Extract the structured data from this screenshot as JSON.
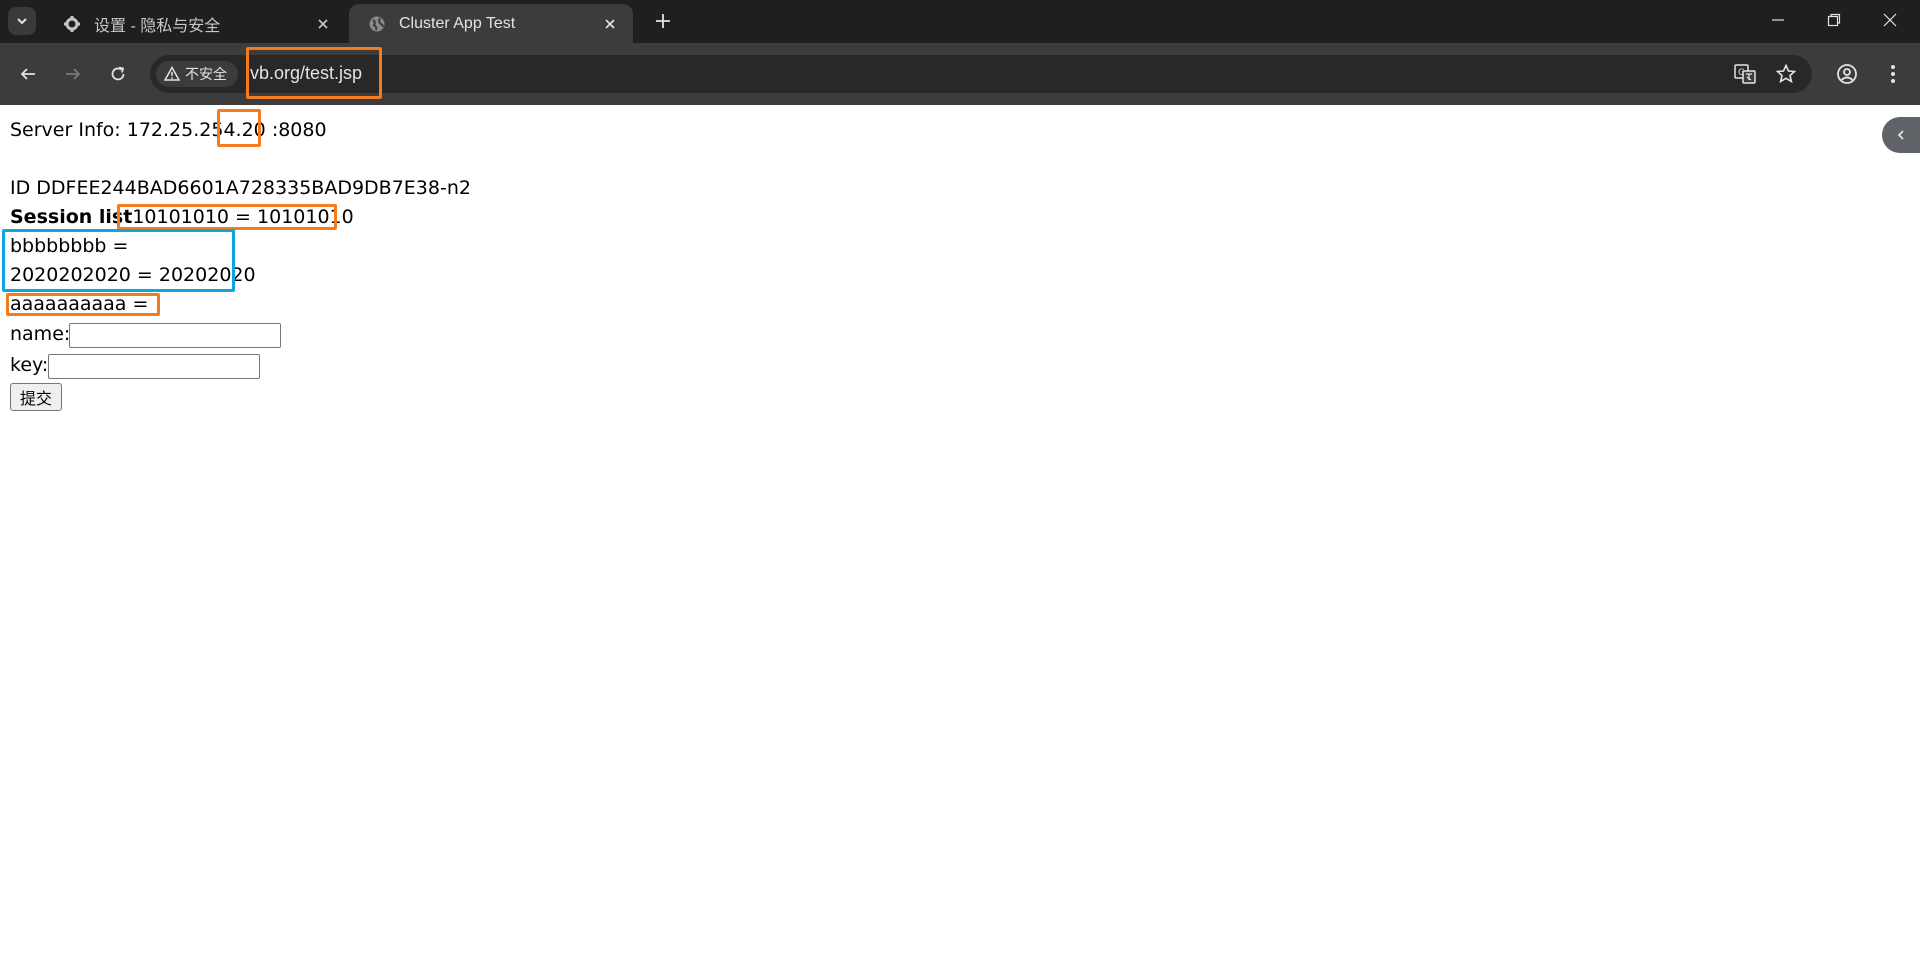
{
  "browser": {
    "tabs": [
      {
        "title": "设置 - 隐私与安全",
        "icon": "gear-icon",
        "active": false
      },
      {
        "title": "Cluster App Test",
        "icon": "globe-icon",
        "active": true
      }
    ],
    "security_label": "不安全",
    "url": "vb.org/test.jsp"
  },
  "page": {
    "server_info_prefix": "Server Info: 172.25.254",
    "server_info_host_suffix": ".20",
    "server_info_port": ":8080",
    "session_id": "ID DDFEE244BAD6601A728335BAD9DB7E38-n2",
    "session_list_label": "Session list",
    "session_entries": [
      "10101010 = 10101010",
      "bbbbbbbb =",
      "2020202020 = 20202020",
      "aaaaaaaaaa ="
    ],
    "name_label": "name:",
    "name_value": "",
    "key_label": "key:",
    "key_value": "",
    "submit_label": "提交"
  },
  "colors": {
    "annotation_orange": "#f47c1f",
    "annotation_blue": "#0ea5e0"
  }
}
